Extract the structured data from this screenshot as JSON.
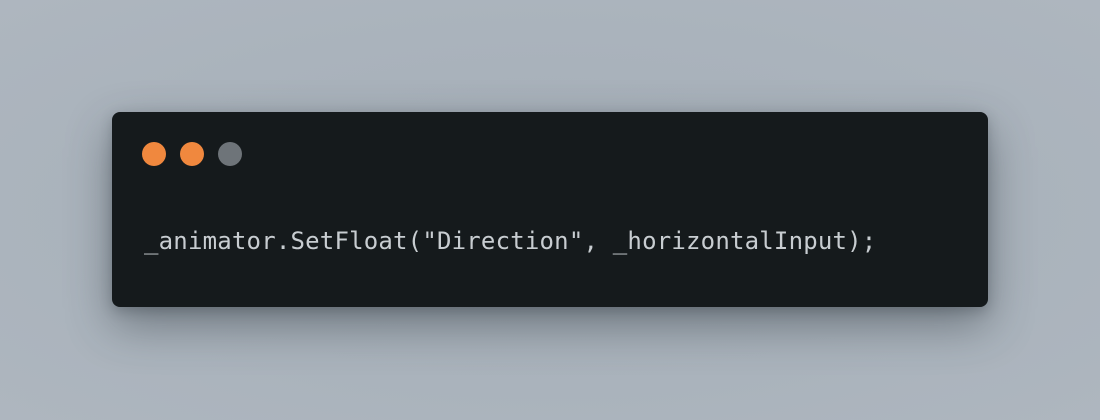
{
  "window": {
    "buttons": [
      {
        "name": "close",
        "color": "#f0883e"
      },
      {
        "name": "minimize",
        "color": "#f0883e"
      },
      {
        "name": "zoom",
        "color": "#6e7479"
      }
    ]
  },
  "code": {
    "line": "_animator.SetFloat(\"Direction\", _horizontalInput);",
    "text_color": "#c8cdd1",
    "background": "#151a1c"
  },
  "page": {
    "background": "#a9b2bb"
  }
}
